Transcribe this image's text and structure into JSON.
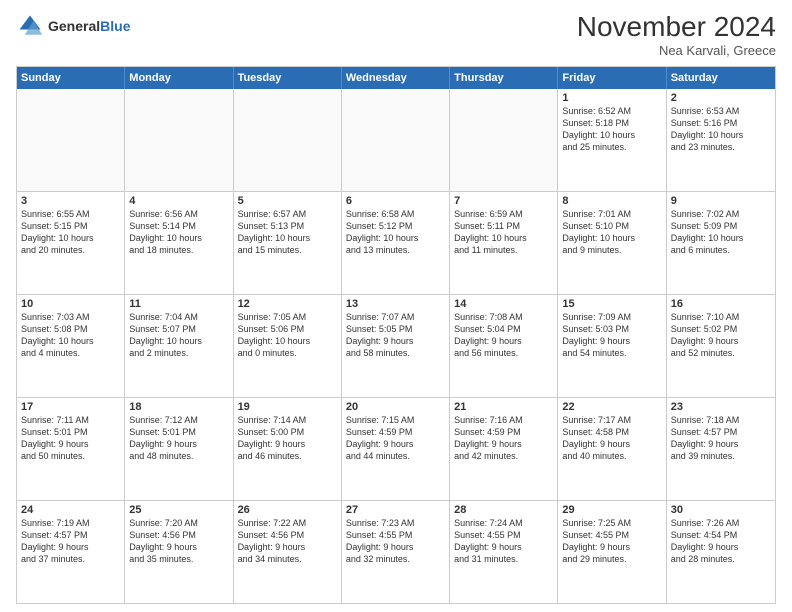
{
  "header": {
    "logo_line1": "General",
    "logo_line2": "Blue",
    "month": "November 2024",
    "location": "Nea Karvali, Greece"
  },
  "days": [
    "Sunday",
    "Monday",
    "Tuesday",
    "Wednesday",
    "Thursday",
    "Friday",
    "Saturday"
  ],
  "weeks": [
    [
      {
        "day": "",
        "empty": true
      },
      {
        "day": "",
        "empty": true
      },
      {
        "day": "",
        "empty": true
      },
      {
        "day": "",
        "empty": true
      },
      {
        "day": "",
        "empty": true
      },
      {
        "day": "1",
        "info": "Sunrise: 6:52 AM\nSunset: 5:18 PM\nDaylight: 10 hours\nand 25 minutes."
      },
      {
        "day": "2",
        "info": "Sunrise: 6:53 AM\nSunset: 5:16 PM\nDaylight: 10 hours\nand 23 minutes."
      }
    ],
    [
      {
        "day": "3",
        "info": "Sunrise: 6:55 AM\nSunset: 5:15 PM\nDaylight: 10 hours\nand 20 minutes."
      },
      {
        "day": "4",
        "info": "Sunrise: 6:56 AM\nSunset: 5:14 PM\nDaylight: 10 hours\nand 18 minutes."
      },
      {
        "day": "5",
        "info": "Sunrise: 6:57 AM\nSunset: 5:13 PM\nDaylight: 10 hours\nand 15 minutes."
      },
      {
        "day": "6",
        "info": "Sunrise: 6:58 AM\nSunset: 5:12 PM\nDaylight: 10 hours\nand 13 minutes."
      },
      {
        "day": "7",
        "info": "Sunrise: 6:59 AM\nSunset: 5:11 PM\nDaylight: 10 hours\nand 11 minutes."
      },
      {
        "day": "8",
        "info": "Sunrise: 7:01 AM\nSunset: 5:10 PM\nDaylight: 10 hours\nand 9 minutes."
      },
      {
        "day": "9",
        "info": "Sunrise: 7:02 AM\nSunset: 5:09 PM\nDaylight: 10 hours\nand 6 minutes."
      }
    ],
    [
      {
        "day": "10",
        "info": "Sunrise: 7:03 AM\nSunset: 5:08 PM\nDaylight: 10 hours\nand 4 minutes."
      },
      {
        "day": "11",
        "info": "Sunrise: 7:04 AM\nSunset: 5:07 PM\nDaylight: 10 hours\nand 2 minutes."
      },
      {
        "day": "12",
        "info": "Sunrise: 7:05 AM\nSunset: 5:06 PM\nDaylight: 10 hours\nand 0 minutes."
      },
      {
        "day": "13",
        "info": "Sunrise: 7:07 AM\nSunset: 5:05 PM\nDaylight: 9 hours\nand 58 minutes."
      },
      {
        "day": "14",
        "info": "Sunrise: 7:08 AM\nSunset: 5:04 PM\nDaylight: 9 hours\nand 56 minutes."
      },
      {
        "day": "15",
        "info": "Sunrise: 7:09 AM\nSunset: 5:03 PM\nDaylight: 9 hours\nand 54 minutes."
      },
      {
        "day": "16",
        "info": "Sunrise: 7:10 AM\nSunset: 5:02 PM\nDaylight: 9 hours\nand 52 minutes."
      }
    ],
    [
      {
        "day": "17",
        "info": "Sunrise: 7:11 AM\nSunset: 5:01 PM\nDaylight: 9 hours\nand 50 minutes."
      },
      {
        "day": "18",
        "info": "Sunrise: 7:12 AM\nSunset: 5:01 PM\nDaylight: 9 hours\nand 48 minutes."
      },
      {
        "day": "19",
        "info": "Sunrise: 7:14 AM\nSunset: 5:00 PM\nDaylight: 9 hours\nand 46 minutes."
      },
      {
        "day": "20",
        "info": "Sunrise: 7:15 AM\nSunset: 4:59 PM\nDaylight: 9 hours\nand 44 minutes."
      },
      {
        "day": "21",
        "info": "Sunrise: 7:16 AM\nSunset: 4:59 PM\nDaylight: 9 hours\nand 42 minutes."
      },
      {
        "day": "22",
        "info": "Sunrise: 7:17 AM\nSunset: 4:58 PM\nDaylight: 9 hours\nand 40 minutes."
      },
      {
        "day": "23",
        "info": "Sunrise: 7:18 AM\nSunset: 4:57 PM\nDaylight: 9 hours\nand 39 minutes."
      }
    ],
    [
      {
        "day": "24",
        "info": "Sunrise: 7:19 AM\nSunset: 4:57 PM\nDaylight: 9 hours\nand 37 minutes."
      },
      {
        "day": "25",
        "info": "Sunrise: 7:20 AM\nSunset: 4:56 PM\nDaylight: 9 hours\nand 35 minutes."
      },
      {
        "day": "26",
        "info": "Sunrise: 7:22 AM\nSunset: 4:56 PM\nDaylight: 9 hours\nand 34 minutes."
      },
      {
        "day": "27",
        "info": "Sunrise: 7:23 AM\nSunset: 4:55 PM\nDaylight: 9 hours\nand 32 minutes."
      },
      {
        "day": "28",
        "info": "Sunrise: 7:24 AM\nSunset: 4:55 PM\nDaylight: 9 hours\nand 31 minutes."
      },
      {
        "day": "29",
        "info": "Sunrise: 7:25 AM\nSunset: 4:55 PM\nDaylight: 9 hours\nand 29 minutes."
      },
      {
        "day": "30",
        "info": "Sunrise: 7:26 AM\nSunset: 4:54 PM\nDaylight: 9 hours\nand 28 minutes."
      }
    ]
  ]
}
